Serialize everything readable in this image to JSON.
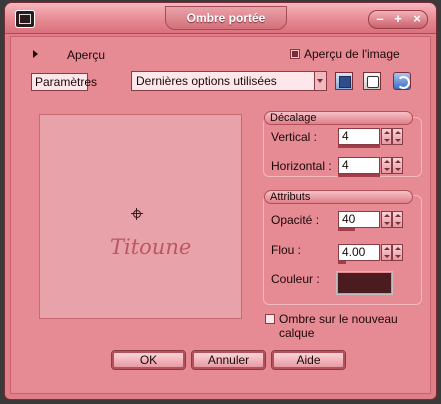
{
  "window": {
    "title": "Ombre portée",
    "minimize": "–",
    "maximize": "+",
    "close": "×"
  },
  "top": {
    "apercu_label": "Aperçu",
    "apercu_image_label": "Aperçu de l'image",
    "parametres_label": "Paramètres",
    "preset_value": "Dernières options utilisées"
  },
  "decalage": {
    "header": "Décalage",
    "vertical_label": "Vertical :",
    "vertical_value": "4",
    "horizontal_label": "Horizontal :",
    "horizontal_value": "4"
  },
  "attributs": {
    "header": "Attributs",
    "opacite_label": "Opacité :",
    "opacite_value": "40",
    "flou_label": "Flou :",
    "flou_value": "4.00",
    "couleur_label": "Couleur :",
    "couleur_hex": "#4a1c1f"
  },
  "ombre_calque_label": "Ombre sur le nouveau calque",
  "buttons": {
    "ok": "OK",
    "annuler": "Annuler",
    "aide": "Aide"
  },
  "preview": {
    "watermark": "Titoune"
  }
}
